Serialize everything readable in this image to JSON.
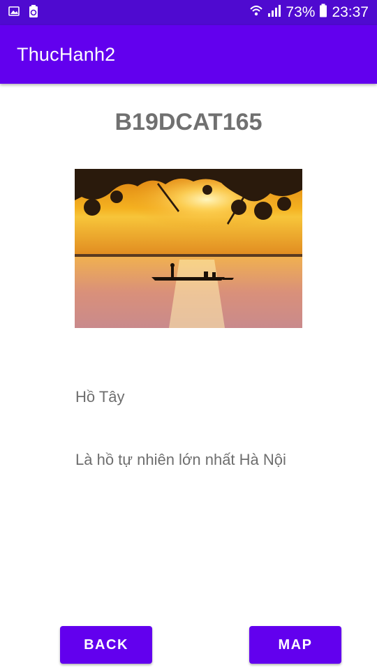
{
  "status_bar": {
    "battery_percent": "73%",
    "time": "23:37",
    "left_icons": [
      "image-icon",
      "recycle-icon"
    ],
    "right_icons": [
      "wifi-icon",
      "signal-icon",
      "battery-icon"
    ]
  },
  "app_bar": {
    "title": "ThucHanh2"
  },
  "main": {
    "code": "B19DCAT165",
    "photo": "sunset-lake-photo",
    "place_name": "Hồ Tây",
    "place_description": "Là hồ tự nhiên lớn nhất Hà Nội"
  },
  "buttons": {
    "back_label": "BACK",
    "map_label": "MAP"
  },
  "colors": {
    "primary": "#6200ee",
    "status_bar": "#4f0ad0",
    "text_gray": "#6e6e6e"
  }
}
